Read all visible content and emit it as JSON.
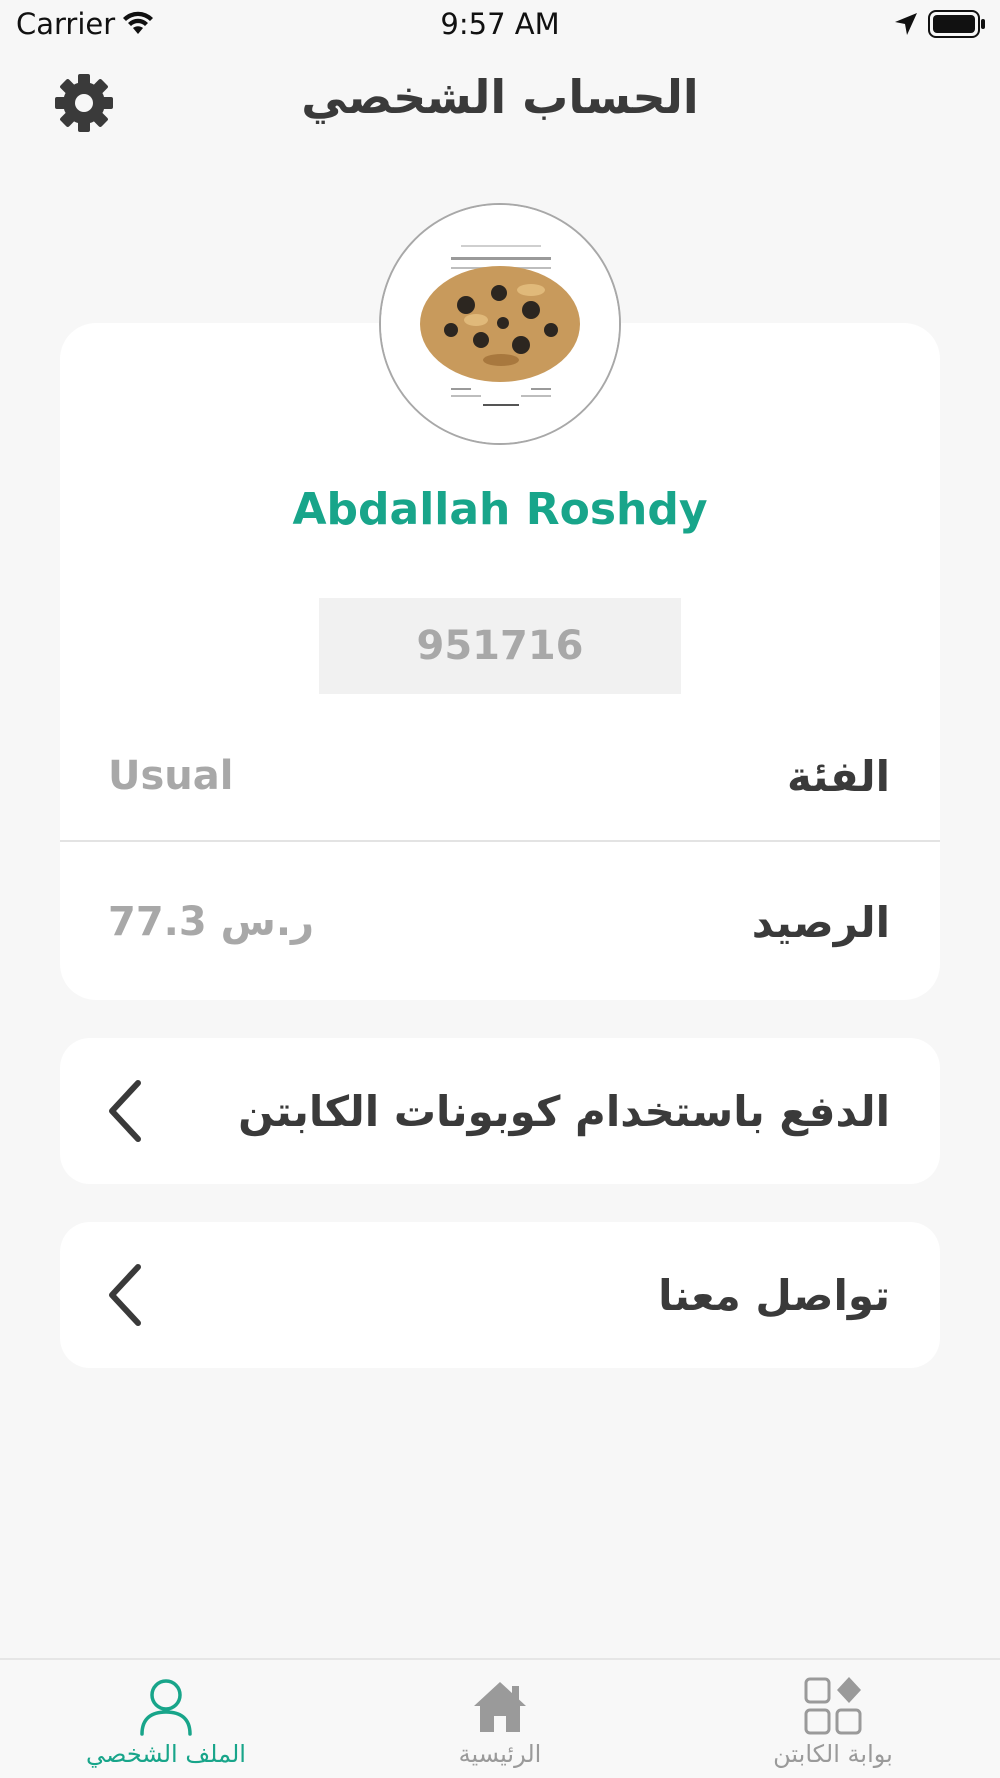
{
  "status_bar": {
    "carrier": "Carrier",
    "time": "9:57 AM"
  },
  "header": {
    "title": "الحساب الشخصي",
    "settings_icon": "gear-icon"
  },
  "profile": {
    "name": "Abdallah Roshdy",
    "user_id": "951716",
    "category_label": "الفئة",
    "category_value": "Usual",
    "balance_label": "الرصيد",
    "balance_value": "77.3 ر.س"
  },
  "menu": [
    {
      "label": "الدفع باستخدام كوبونات الكابتن",
      "icon": "chevron-left-icon"
    },
    {
      "label": "تواصل معنا",
      "icon": "chevron-left-icon"
    }
  ],
  "tab_bar": {
    "tabs": [
      {
        "label": "الملف الشخصي",
        "icon": "user-icon",
        "active": true
      },
      {
        "label": "الرئيسية",
        "icon": "home-icon",
        "active": false
      },
      {
        "label": "بوابة الكابتن",
        "icon": "grid-icon",
        "active": false
      }
    ]
  },
  "colors": {
    "accent": "#18a58a",
    "background": "#f7f7f7",
    "card": "#ffffff",
    "text_primary": "#3a3a3a",
    "text_muted": "#a8a8a8"
  }
}
